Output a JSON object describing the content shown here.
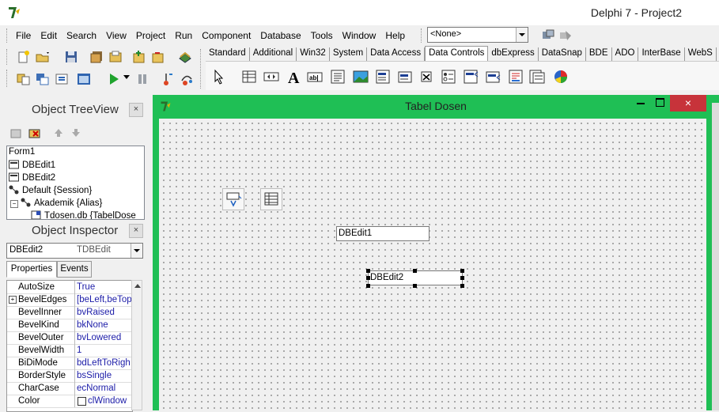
{
  "window": {
    "title": "Delphi 7 - Project2"
  },
  "menu": [
    "File",
    "Edit",
    "Search",
    "View",
    "Project",
    "Run",
    "Component",
    "Database",
    "Tools",
    "Window",
    "Help"
  ],
  "desktop_combo": {
    "value": "<None>"
  },
  "palette": {
    "tabs": [
      "Standard",
      "Additional",
      "Win32",
      "System",
      "Data Access",
      "Data Controls",
      "dbExpress",
      "DataSnap",
      "BDE",
      "ADO",
      "InterBase",
      "WebS"
    ],
    "active_tab": "Data Controls"
  },
  "object_treeview": {
    "title": "Object TreeView",
    "items": [
      "Form1",
      "DBEdit1",
      "DBEdit2",
      "Default {Session}",
      "Akademik {Alias}",
      "Tdosen.db {TabelDose"
    ]
  },
  "object_inspector": {
    "title": "Object Inspector",
    "selected_name": "DBEdit2",
    "selected_type": "TDBEdit",
    "tabs": [
      "Properties",
      "Events"
    ],
    "properties": [
      {
        "name": "AutoSize",
        "value": "True"
      },
      {
        "name": "BevelEdges",
        "value": "[beLeft,beTop"
      },
      {
        "name": "BevelInner",
        "value": "bvRaised"
      },
      {
        "name": "BevelKind",
        "value": "bkNone"
      },
      {
        "name": "BevelOuter",
        "value": "bvLowered"
      },
      {
        "name": "BevelWidth",
        "value": "1"
      },
      {
        "name": "BiDiMode",
        "value": "bdLeftToRigh"
      },
      {
        "name": "BorderStyle",
        "value": "bsSingle"
      },
      {
        "name": "CharCase",
        "value": "ecNormal"
      },
      {
        "name": "Color",
        "value": "clWindow"
      }
    ]
  },
  "form": {
    "title": "Tabel Dosen",
    "dbedit1_text": "DBEdit1",
    "dbedit2_text": "DBEdit2"
  },
  "colors": {
    "form_border": "#1fbf55",
    "close_button": "#c7333a",
    "property_value": "#1c1ca8"
  }
}
